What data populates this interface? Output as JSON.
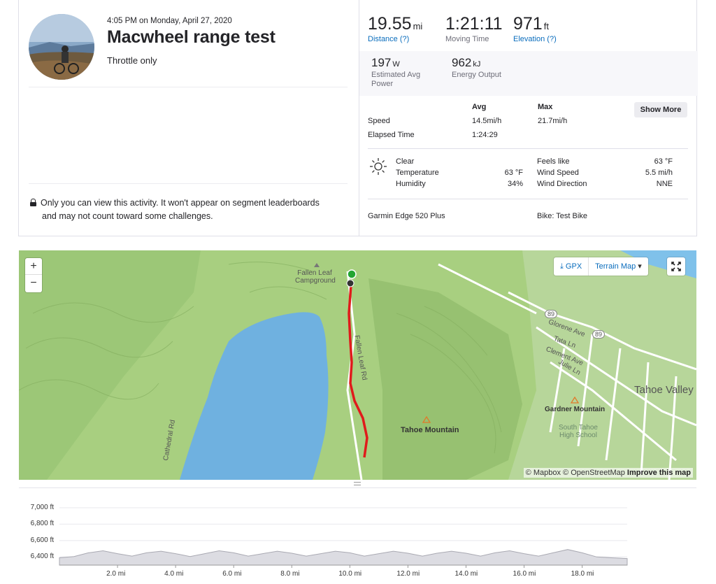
{
  "activity": {
    "timestamp": "4:05 PM on Monday, April 27, 2020",
    "title": "Macwheel range test",
    "description": "Throttle only",
    "privacy_line1": "Only you can view this activity. It won't appear on segment leaderboards",
    "privacy_line2": "and may not count toward some challenges."
  },
  "stats": {
    "distance": {
      "value": "19.55",
      "unit": "mi",
      "label": "Distance (?)"
    },
    "moving_time": {
      "value": "1:21:11",
      "label": "Moving Time"
    },
    "elevation": {
      "value": "971",
      "unit": "ft",
      "label": "Elevation (?)"
    },
    "power": {
      "value": "197",
      "unit": "W",
      "label": "Estimated Avg Power"
    },
    "energy": {
      "value": "962",
      "unit": "kJ",
      "label": "Energy Output"
    }
  },
  "details": {
    "col_avg": "Avg",
    "col_max": "Max",
    "show_more": "Show More",
    "speed": {
      "label": "Speed",
      "avg": "14.5mi/h",
      "max": "21.7mi/h"
    },
    "elapsed": {
      "label": "Elapsed Time",
      "avg": "1:24:29"
    }
  },
  "weather": {
    "icon": "sun-icon",
    "condition": "Clear",
    "temperature_label": "Temperature",
    "temperature": "63 °F",
    "humidity_label": "Humidity",
    "humidity": "34%",
    "feels_like_label": "Feels like",
    "feels_like": "63 °F",
    "wind_speed_label": "Wind Speed",
    "wind_speed": "5.5 mi/h",
    "wind_dir_label": "Wind Direction",
    "wind_dir": "NNE"
  },
  "gear": {
    "device": "Garmin Edge 520 Plus",
    "bike": "Bike: Test Bike"
  },
  "map": {
    "zoom_in": "+",
    "zoom_out": "−",
    "gpx": "GPX",
    "map_type": "Terrain Map",
    "attribution_mapbox": "© Mapbox",
    "attribution_osm": "© OpenStreetMap",
    "improve": "Improve this map",
    "labels": {
      "campground": "Fallen Leaf Campground",
      "tahoe_mtn": "Tahoe Mountain",
      "gardner_mtn": "Gardner Mountain",
      "school": "South Tahoe High School",
      "tahoe_valley": "Tahoe Valley",
      "road": "Fallen Leaf Rd",
      "glorene": "Glorene Ave",
      "tata": "Tata Ln",
      "clement": "Clement Ave",
      "julie": "Julie Ln",
      "hwy": "89",
      "ridge": "Cathedral Rd"
    },
    "route_color": "#e01b1b",
    "water_color": "#6fb1e0"
  },
  "chart_data": {
    "type": "area",
    "title": "",
    "xlabel": "",
    "ylabel": "",
    "xlim": [
      0,
      19.55
    ],
    "ylim": [
      6300,
      7000
    ],
    "yticks": [
      "7,000 ft",
      "6,800 ft",
      "6,600 ft",
      "6,400 ft"
    ],
    "xticks": [
      "2.0 mi",
      "4.0 mi",
      "6.0 mi",
      "8.0 mi",
      "10.0 mi",
      "12.0 mi",
      "14.0 mi",
      "16.0 mi",
      "18.0 mi"
    ],
    "x": [
      0,
      0.5,
      1,
      1.5,
      2,
      2.5,
      3,
      3.5,
      4,
      4.5,
      5,
      5.5,
      6,
      6.5,
      7,
      7.5,
      8,
      8.5,
      9,
      9.5,
      10,
      10.5,
      11,
      11.5,
      12,
      12.5,
      13,
      13.5,
      14,
      14.5,
      15,
      15.5,
      16,
      16.5,
      17,
      17.5,
      18,
      18.5,
      19,
      19.55
    ],
    "y": [
      6390,
      6405,
      6450,
      6475,
      6440,
      6410,
      6450,
      6470,
      6440,
      6405,
      6440,
      6475,
      6450,
      6410,
      6440,
      6470,
      6445,
      6410,
      6440,
      6470,
      6450,
      6410,
      6440,
      6470,
      6445,
      6410,
      6445,
      6470,
      6445,
      6410,
      6450,
      6475,
      6440,
      6410,
      6450,
      6490,
      6450,
      6400,
      6390,
      6380
    ]
  }
}
